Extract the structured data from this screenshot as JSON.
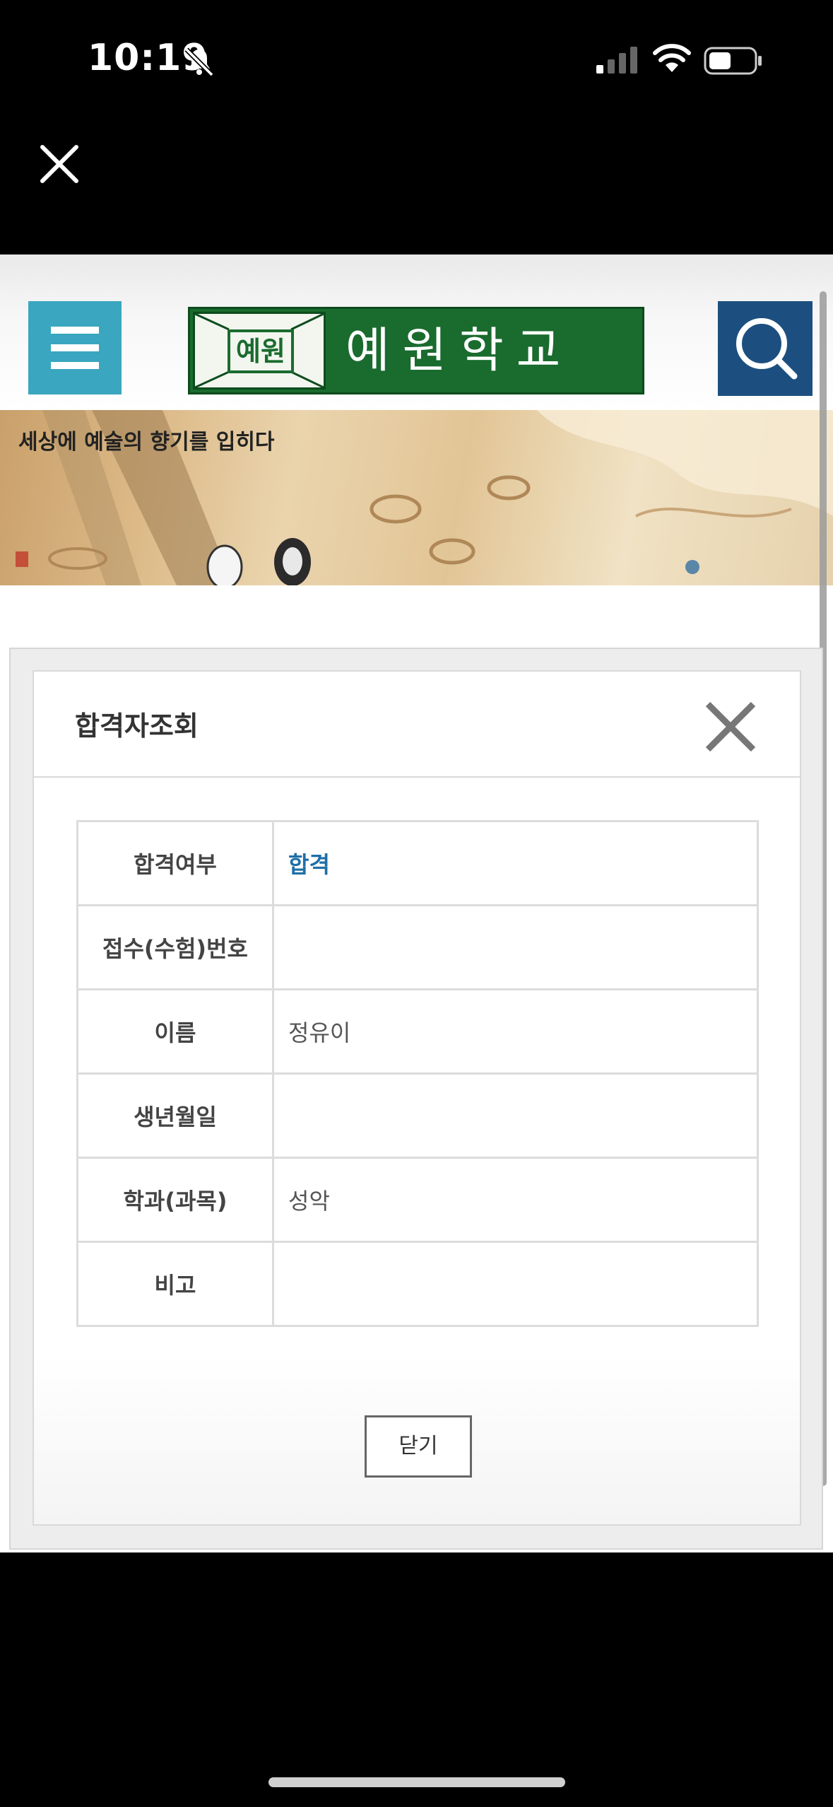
{
  "status_bar": {
    "time": "10:19"
  },
  "header": {
    "logo_emblem": "예원",
    "logo_text": "예원학교"
  },
  "banner": {
    "tagline": "세상에 예술의 향기를 입히다"
  },
  "modal": {
    "title": "합격자조회",
    "rows": [
      {
        "label": "합격여부",
        "value": "합격"
      },
      {
        "label": "접수(수험)번호",
        "value": ""
      },
      {
        "label": "이름",
        "value": "정유이"
      },
      {
        "label": "생년월일",
        "value": ""
      },
      {
        "label": "학과(과목)",
        "value": "성악"
      },
      {
        "label": "비고",
        "value": ""
      }
    ],
    "close_label": "닫기"
  },
  "colors": {
    "menu_button": "#3aa6bf",
    "logo_green": "#1a6b2e",
    "search_button": "#1c4f7f",
    "pass_text": "#1f6fa6"
  },
  "icons": [
    "bell-slash-icon",
    "cellular-signal-icon",
    "wifi-icon",
    "battery-icon",
    "close-icon",
    "hamburger-menu-icon",
    "search-icon"
  ]
}
